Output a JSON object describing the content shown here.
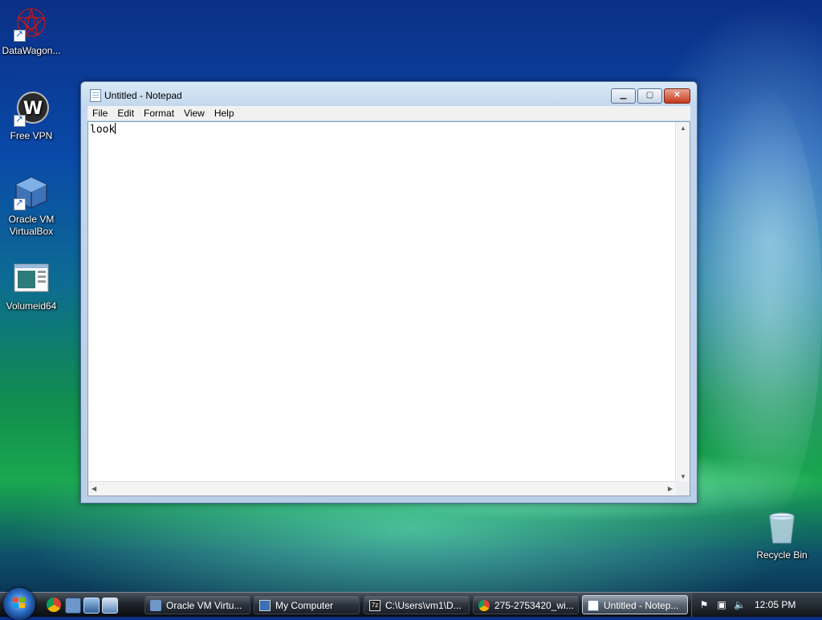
{
  "desktop": {
    "icons": [
      {
        "label": "DataWagon...",
        "icon": "datawagon-icon"
      },
      {
        "label": "Free VPN",
        "icon": "free-vpn-icon"
      },
      {
        "label": "Oracle VM\nVirtualBox",
        "icon": "virtualbox-icon"
      },
      {
        "label": "Volumeid64",
        "icon": "volumeid-icon"
      },
      {
        "label": "Recycle Bin",
        "icon": "recycle-bin-icon"
      }
    ]
  },
  "notepad": {
    "title": "Untitled - Notepad",
    "menu": [
      "File",
      "Edit",
      "Format",
      "View",
      "Help"
    ],
    "content": "look",
    "buttons": {
      "minimize": "minimize",
      "maximize": "maximize",
      "close": "close"
    }
  },
  "taskbar": {
    "quick_launch": [
      "chrome-icon",
      "virtualbox-icon",
      "show-desktop-icon",
      "switch-windows-icon"
    ],
    "tasks": [
      {
        "label": "Oracle VM Virtu...",
        "icon": "virtualbox-icon",
        "active": false
      },
      {
        "label": "My Computer",
        "icon": "computer-icon",
        "active": false
      },
      {
        "label": "C:\\Users\\vm1\\D...",
        "icon": "7zip-icon",
        "active": false
      },
      {
        "label": "275-2753420_wi...",
        "icon": "chrome-icon",
        "active": false
      },
      {
        "label": "Untitled - Notep...",
        "icon": "notepad-icon",
        "active": true
      }
    ],
    "tray": {
      "icons": [
        "action-center-icon",
        "network-icon",
        "volume-icon"
      ],
      "time": "12:05 PM"
    }
  },
  "colors": {
    "accent": "#1b5fd1",
    "close": "#c8381b",
    "desktop_green": "#1aa84f",
    "desktop_blue": "#0a49a8"
  }
}
